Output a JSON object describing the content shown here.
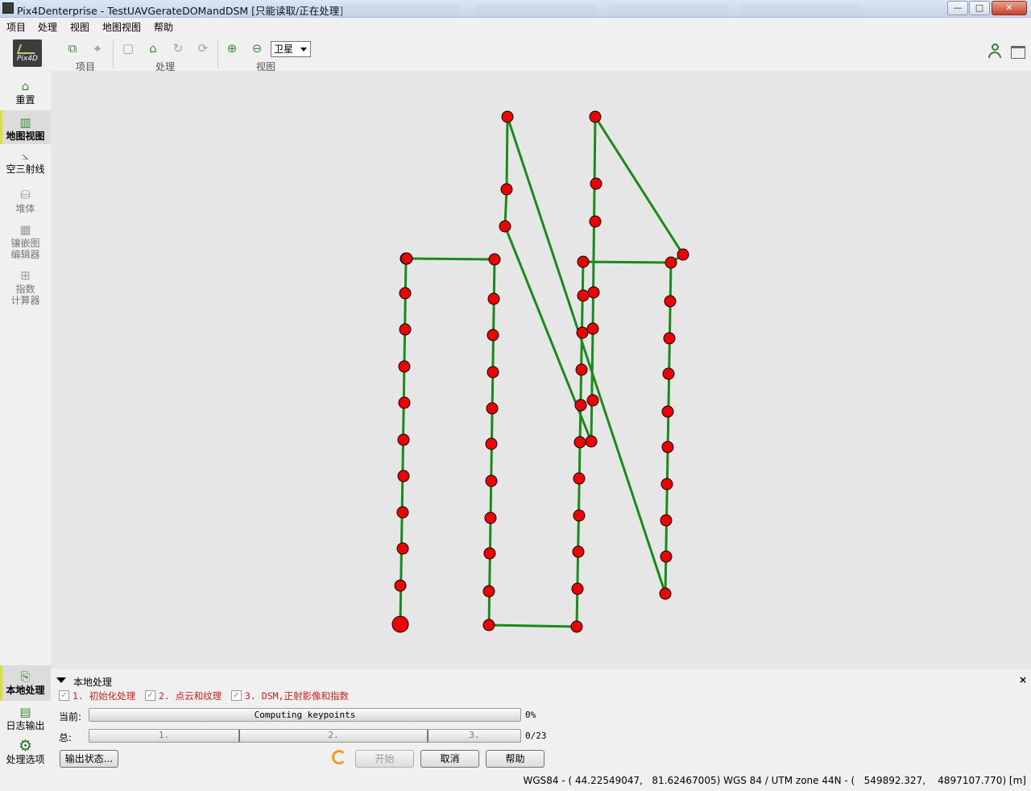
{
  "window": {
    "title": "Pix4Denterprise - TestUAVGerateDOMandDSM [只能读取/正在处理]",
    "controls": {
      "minimize": "—",
      "maximize": "□",
      "close": "✕"
    }
  },
  "menu": [
    "项目",
    "处理",
    "视图",
    "地图视图",
    "帮助"
  ],
  "toolbar": {
    "logo_text": "Pix4D",
    "groups": {
      "project": "项目",
      "processing": "处理",
      "view": "视图"
    },
    "view_select": {
      "value": "卫星"
    }
  },
  "sidebar": {
    "items": [
      {
        "label": "重置",
        "icon": "home-icon"
      },
      {
        "label": "地图视图",
        "icon": "map-icon",
        "active": true
      },
      {
        "label": "空三射线",
        "icon": "rays-icon"
      },
      {
        "label": "堆体",
        "icon": "volume-icon",
        "dim": true
      },
      {
        "label": "镶嵌图\n编辑器",
        "icon": "mosaic-editor-icon",
        "dim": true
      },
      {
        "label": "指数\n计算器",
        "icon": "index-calculator-icon",
        "dim": true
      }
    ],
    "bottom_items": [
      {
        "label": "本地处理",
        "icon": "local-processing-icon",
        "active": true
      },
      {
        "label": "日志输出",
        "icon": "log-icon"
      },
      {
        "label": "处理选项",
        "icon": "gear-icon"
      }
    ]
  },
  "flight_path": {
    "line_color": "#1a8a1a",
    "point_color": "#ee0000"
  },
  "processing": {
    "panel_title": "本地处理",
    "close": "×",
    "steps": [
      {
        "label": "1. 初始化处理",
        "checked": true
      },
      {
        "label": "2. 点云和纹理",
        "checked": true
      },
      {
        "label": "3. DSM,正射影像和指数",
        "checked": true
      }
    ],
    "current_label": "当前:",
    "current_task": "Computing keypoints",
    "current_percent": "0%",
    "current_progress": 0,
    "total_label": "总:",
    "total_segments": [
      "1.",
      "2.",
      "3."
    ],
    "total_count": "0/23",
    "buttons": {
      "output_status": "输出状态...",
      "start": "开始",
      "cancel": "取消",
      "help": "帮助"
    }
  },
  "status": {
    "coordinates": "WGS84 - ( 44.22549047,   81.62467005) WGS 84 / UTM zone 44N - (   549892.327,    4897107.770) [m]"
  }
}
